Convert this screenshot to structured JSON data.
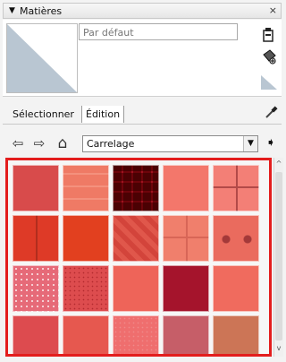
{
  "panel": {
    "collapse_arrow": "▼",
    "title": "Matières",
    "close_label": "×"
  },
  "preview": {
    "material_name": "Par défaut"
  },
  "tabs": [
    {
      "label": "Sélectionner"
    },
    {
      "label": "Édition"
    }
  ],
  "toolbar": {
    "back_icon": "⇦",
    "forward_icon": "⇨",
    "home_icon": "⌂",
    "collection_value": "Carrelage",
    "dropdown_arrow": "▼",
    "details_icon": "➧"
  },
  "scrollbar": {
    "up_arrow": "^",
    "down_arrow": "v"
  },
  "icons": [
    "collapse-arrow-icon",
    "close-icon",
    "create-material-icon",
    "paint-bucket-icon",
    "sample-paint-icon",
    "back-icon",
    "forward-icon",
    "home-icon",
    "details-arrow-icon"
  ],
  "colors": {
    "highlight_border": "#e31d1d",
    "tile_tint": "#f05f55"
  }
}
